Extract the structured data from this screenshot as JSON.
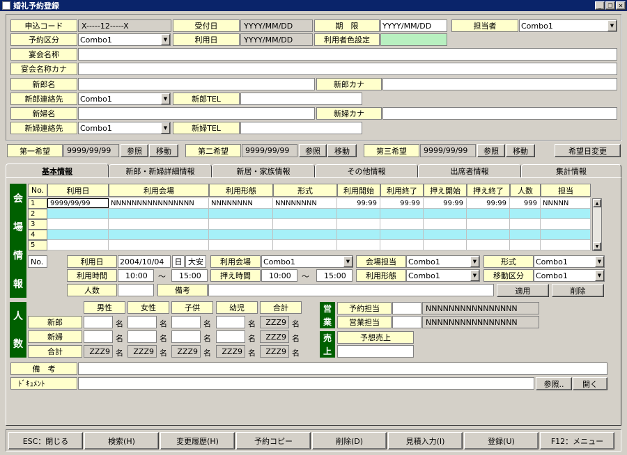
{
  "window": {
    "title": "婚礼予約登録"
  },
  "row1": {
    "moushikomi_label": "申込コード",
    "moushikomi_value": "X-----12-----X",
    "uketsuke_label": "受付日",
    "uketsuke_value": "YYYY/MM/DD",
    "kigen_label": "期　限",
    "kigen_value": "YYYY/MM/DD",
    "tanto_label": "担当者",
    "tanto_value": "Combo1"
  },
  "row2": {
    "yoyaku_kubun_label": "予約区分",
    "yoyaku_kubun_value": "Combo1",
    "riyoubi_label": "利用日",
    "riyoubi_value": "YYYY/MM/DD",
    "color_label": "利用者色設定",
    "color_value": "#b8f0c0"
  },
  "row3": {
    "label": "宴会名称"
  },
  "row4": {
    "label": "宴会名称カナ"
  },
  "row5": {
    "label": "新郎名",
    "kana_label": "新郎カナ"
  },
  "row6": {
    "label": "新郎連絡先",
    "value": "Combo1",
    "tel_label": "新郎TEL"
  },
  "row7": {
    "label": "新婦名",
    "kana_label": "新婦カナ"
  },
  "row8": {
    "label": "新婦連絡先",
    "value": "Combo1",
    "tel_label": "新婦TEL"
  },
  "kibou": [
    {
      "label": "第一希望",
      "value": "9999/99/99",
      "ref": "参照",
      "move": "移動"
    },
    {
      "label": "第二希望",
      "value": "9999/99/99",
      "ref": "参照",
      "move": "移動"
    },
    {
      "label": "第三希望",
      "value": "9999/99/99",
      "ref": "参照",
      "move": "移動"
    }
  ],
  "kibou_change": "希望日変更",
  "tabs": [
    "基本情報",
    "新郎・新婦詳細情報",
    "新居・家族情報",
    "その他情報",
    "出席者情報",
    "集計情報"
  ],
  "venue": {
    "side_label": [
      "会",
      "場",
      "情",
      "報"
    ],
    "headers": [
      "No.",
      "利用日",
      "利用会場",
      "利用形態",
      "形式",
      "利用開始",
      "利用終了",
      "押え開始",
      "押え終了",
      "人数",
      "担当"
    ],
    "rows": [
      [
        "1",
        "9999/99/99",
        "NNNNNNNNNNNNNNNN",
        "NNNNNNNN",
        "NNNNNNNN",
        "99:99",
        "99:99",
        "99:99",
        "99:99",
        "999",
        "NNNNN"
      ],
      [
        "2",
        "",
        "",
        "",
        "",
        "",
        "",
        "",
        "",
        "",
        ""
      ],
      [
        "3",
        "",
        "",
        "",
        "",
        "",
        "",
        "",
        "",
        "",
        ""
      ],
      [
        "4",
        "",
        "",
        "",
        "",
        "",
        "",
        "",
        "",
        "",
        ""
      ],
      [
        "5",
        "",
        "",
        "",
        "",
        "",
        "",
        "",
        "",
        "",
        ""
      ]
    ]
  },
  "detail": {
    "no_label": "No.",
    "riyoubi_label": "利用日",
    "riyoubi_value": "2004/10/04",
    "youbi": "日",
    "rokuyo": "大安",
    "kaijo_label": "利用会場",
    "kaijo_value": "Combo1",
    "kaijo_tanto_label": "会場担当",
    "kaijo_tanto_value": "Combo1",
    "keishiki_label": "形式",
    "keishiki_value": "Combo1",
    "jikan_label": "利用時間",
    "jikan_from": "10:00",
    "tilde": "～",
    "jikan_to": "15:00",
    "osae_label": "押え時間",
    "osae_from": "10:00",
    "osae_to": "15:00",
    "keitai_label": "利用形態",
    "keitai_value": "Combo1",
    "idou_label": "移動区分",
    "idou_value": "Combo1",
    "ninzu_label": "人数",
    "bikou_label": "備考",
    "apply": "適用",
    "delete": "削除"
  },
  "people": {
    "side_label": [
      "人",
      "数"
    ],
    "headers": [
      "男性",
      "女性",
      "子供",
      "幼児",
      "合計"
    ],
    "rows": [
      {
        "label": "新郎",
        "values": [
          "",
          "",
          "",
          "",
          "ZZZ9"
        ]
      },
      {
        "label": "新婦",
        "values": [
          "",
          "",
          "",
          "",
          "ZZZ9"
        ]
      },
      {
        "label": "合計",
        "values": [
          "ZZZ9",
          "ZZZ9",
          "ZZZ9",
          "ZZZ9",
          "ZZZ9"
        ]
      }
    ],
    "unit": "名"
  },
  "eigyo": {
    "side_label": [
      "営",
      "業"
    ],
    "yoyaku_label": "予約担当",
    "yoyaku_value": "NNNNNNNNNNNNNNNN",
    "eigyo_label": "営業担当",
    "eigyo_value": "NNNNNNNNNNNNNNNN"
  },
  "uriage": {
    "side_label": [
      "売",
      "上"
    ],
    "label": "予想売上"
  },
  "bikou_label": "備　考",
  "document_label": "ﾄﾞｷｭﾒﾝﾄ",
  "doc_ref": "参照..",
  "doc_open": "開く",
  "footer": [
    "ESC：閉じる",
    "検索(H)",
    "変更履歴(H)",
    "予約コピー",
    "削除(D)",
    "見積入力(I)",
    "登録(U)",
    "F12：メニュー"
  ]
}
